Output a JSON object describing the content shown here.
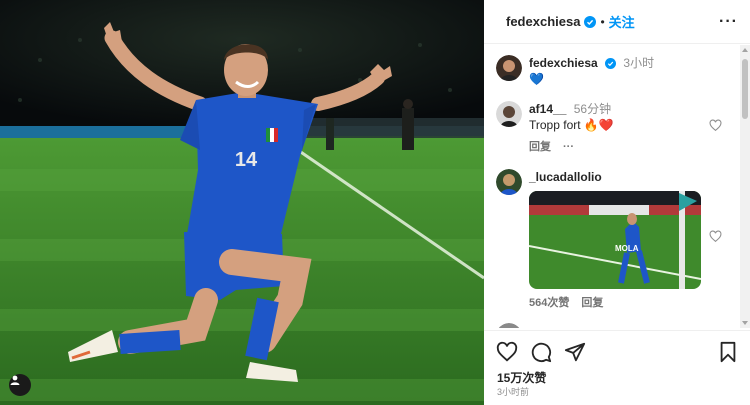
{
  "post": {
    "author": "fedexchiesa",
    "follow_label": "关注",
    "more_label": "···",
    "caption_time": "3小时",
    "caption_emoji": "💙",
    "likes": "15万次赞",
    "posted_time": "3小时前"
  },
  "media": {
    "jersey_number": "14",
    "board_label": "MOLA"
  },
  "comments": [
    {
      "user": "af14__",
      "time": "56分钟",
      "text": "Tropp fort 🔥❤️",
      "reply_label": "回复",
      "more": "···"
    },
    {
      "user": "_lucadallolio",
      "likes": "564次赞",
      "reply_label": "回复"
    }
  ],
  "colors": {
    "accent": "#0095f6",
    "jersey": "#1e56c8",
    "pitch": "#3f8a2c"
  }
}
